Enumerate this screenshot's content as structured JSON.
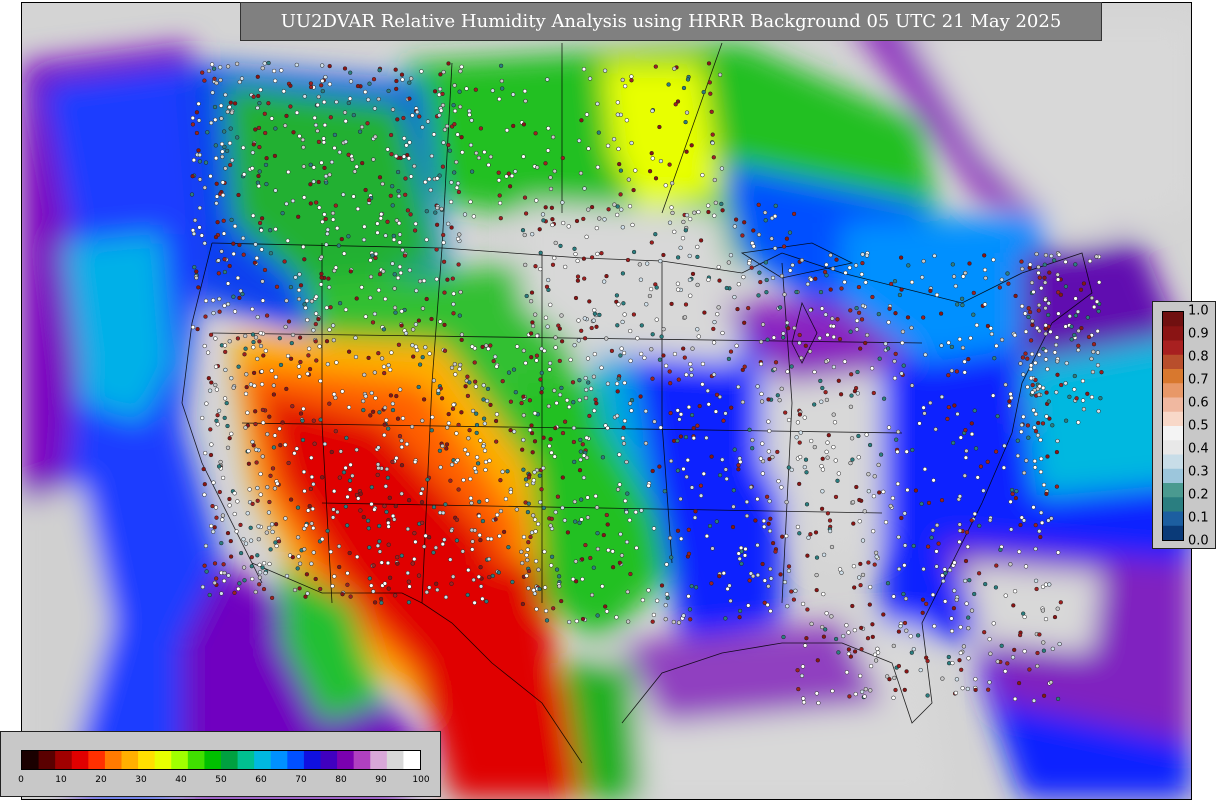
{
  "title": "UU2DVAR Relative Humidity Analysis using HRRR Background 05 UTC 21 May 2025",
  "rh_colorbar": {
    "ticks": [
      "0",
      "10",
      "20",
      "30",
      "40",
      "50",
      "60",
      "70",
      "80",
      "90",
      "100"
    ],
    "colors": [
      "#1a0000",
      "#5a0000",
      "#a00000",
      "#e00000",
      "#ff3000",
      "#ff7a00",
      "#ffb000",
      "#ffe000",
      "#e8ff00",
      "#a0ff00",
      "#40e000",
      "#00c000",
      "#00a040",
      "#00c090",
      "#00b8e0",
      "#0090ff",
      "#0050ff",
      "#1010e0",
      "#4000c0",
      "#7a00b0",
      "#b040c0",
      "#d8a8d8",
      "#d8d8d8",
      "#ffffff"
    ]
  },
  "error_colorbar": {
    "ticks": [
      "0.0",
      "0.1",
      "0.2",
      "0.3",
      "0.4",
      "0.5",
      "0.6",
      "0.7",
      "0.8",
      "0.9",
      "1.0"
    ],
    "colors": [
      "#0a3a78",
      "#1c5ea0",
      "#2a7e80",
      "#4a9a90",
      "#9cc6dc",
      "#c8dde8",
      "#e8e8e8",
      "#f4f4f4",
      "#f8d8c8",
      "#f0b8a0",
      "#e89868",
      "#d8782e",
      "#b84e2c",
      "#a82020",
      "#8a1414",
      "#701010"
    ]
  },
  "map": {
    "colors": {
      "dry": "#e00000",
      "orange": "#ff8a00",
      "yellow": "#f0ff00",
      "green": "#20c020",
      "cyan": "#00b0e0",
      "blue": "#1030ff",
      "purple": "#7000c0",
      "saturated": "#d8d8d8",
      "ocean_blue": "#2070ff",
      "boundary": "#000000"
    }
  }
}
